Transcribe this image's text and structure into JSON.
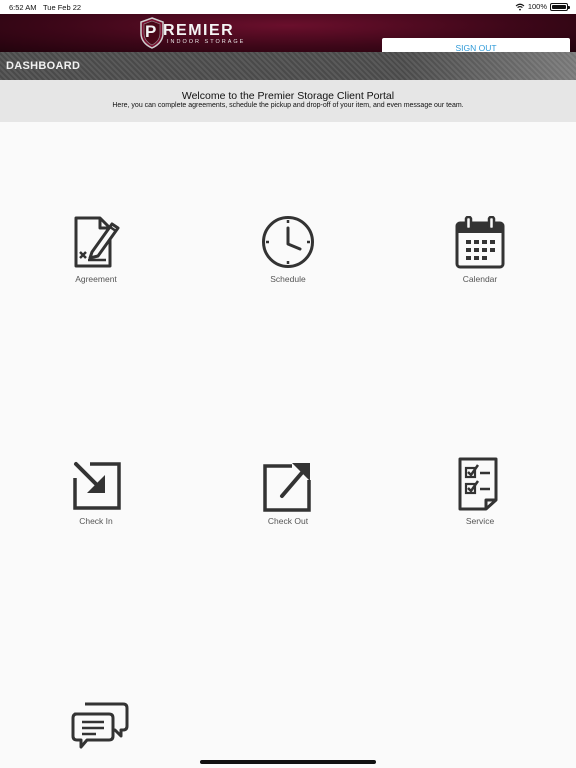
{
  "status": {
    "time": "6:52 AM",
    "date": "Tue Feb 22",
    "battery": "100%"
  },
  "header": {
    "brand": "REMIER",
    "brand_initial": "P",
    "tagline": "INDOOR STORAGE",
    "signout_label": "SIGN OUT"
  },
  "dashboard": {
    "title": "DASHBOARD"
  },
  "welcome": {
    "heading": "Welcome to the Premier Storage Client Portal",
    "subtext": "Here, you can complete agreements, schedule the pickup and drop-off of your item, and even message our team."
  },
  "tiles": [
    {
      "label": "Agreement",
      "icon": "agreement-icon"
    },
    {
      "label": "Schedule",
      "icon": "clock-icon"
    },
    {
      "label": "Calendar",
      "icon": "calendar-icon"
    },
    {
      "label": "Check In",
      "icon": "check-in-icon"
    },
    {
      "label": "Check Out",
      "icon": "check-out-icon"
    },
    {
      "label": "Service",
      "icon": "service-checklist-icon"
    },
    {
      "label": "",
      "icon": "message-icon"
    }
  ],
  "colors": {
    "header": "#3e0719",
    "accent": "#2f9ad8",
    "icon": "#333333"
  }
}
